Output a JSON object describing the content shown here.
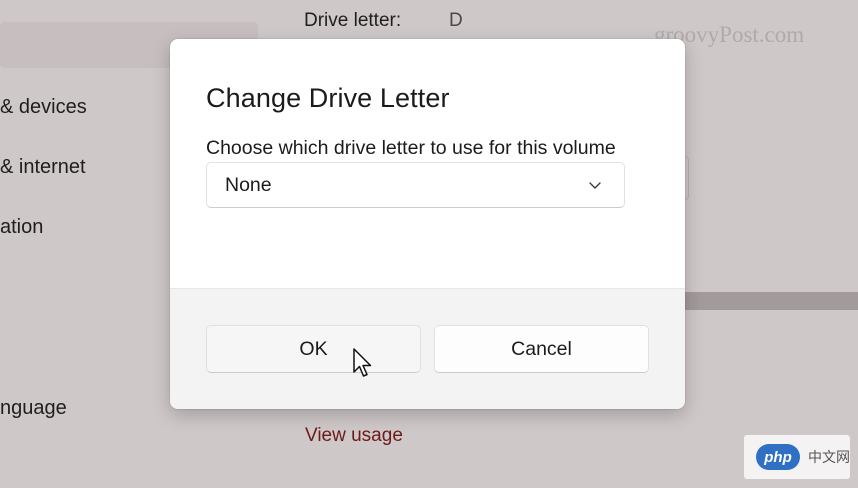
{
  "background": {
    "nav_items": [
      {
        "label": "& devices"
      },
      {
        "label": "& internet"
      },
      {
        "label": "ation"
      },
      {
        "label": "nguage"
      }
    ],
    "drive_letter_label": "Drive letter:",
    "drive_letter_value": "D",
    "view_usage_link": "View usage",
    "watermark": "groovyPost.com",
    "badge": {
      "logo": "php",
      "text": "中文网"
    }
  },
  "dialog": {
    "title": "Change Drive Letter",
    "description": "Choose which drive letter to use for this volume",
    "dropdown": {
      "selected": "None",
      "icon": "chevron-down-icon"
    },
    "buttons": {
      "ok": "OK",
      "cancel": "Cancel"
    }
  },
  "colors": {
    "dialog_bg": "#ffffff",
    "footer_bg": "#f3f3f3",
    "overlay_bg": "#cfc8c8",
    "link": "#6e1a1a"
  }
}
